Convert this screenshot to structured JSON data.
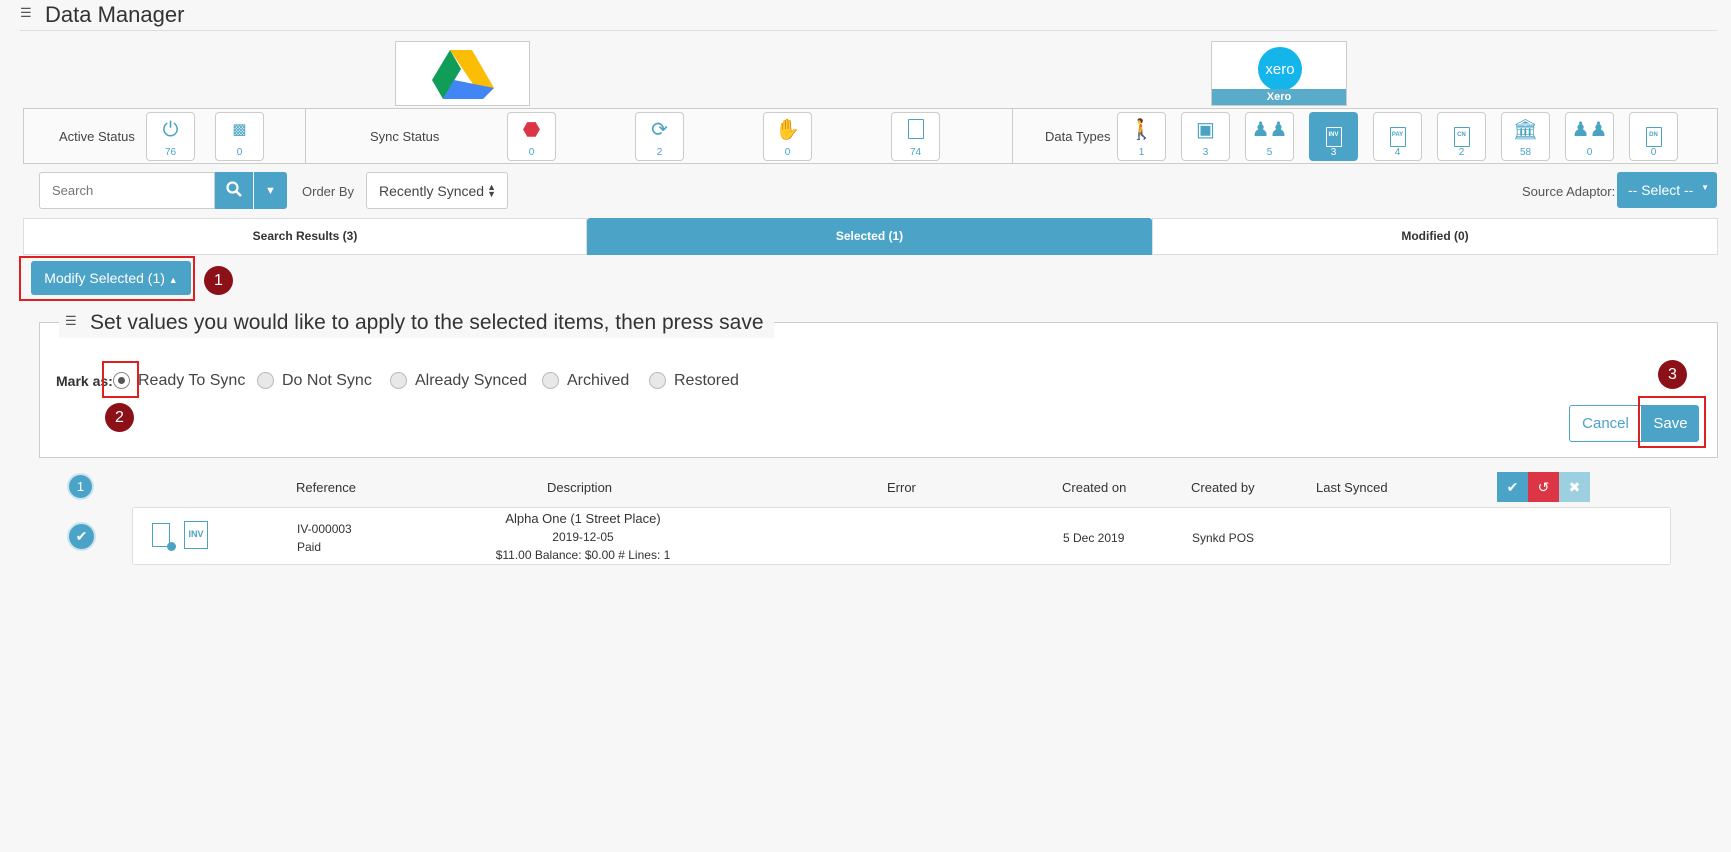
{
  "app": {
    "title": "Data Manager"
  },
  "sources": {
    "right_label": "Xero",
    "right_logo_text": "xero"
  },
  "active_status": {
    "label": "Active Status",
    "tiles": [
      {
        "icon": "power-icon",
        "count": "76"
      },
      {
        "icon": "archive-icon",
        "count": "0"
      }
    ]
  },
  "sync_status": {
    "label": "Sync Status",
    "tiles": [
      {
        "icon": "error-icon",
        "count": "0"
      },
      {
        "icon": "refresh-icon",
        "count": "2"
      },
      {
        "icon": "hand-stop-icon",
        "count": "0"
      },
      {
        "icon": "doc-synced-icon",
        "count": "74"
      }
    ]
  },
  "data_types": {
    "label": "Data Types",
    "tiles": [
      {
        "icon": "person-trolley-icon",
        "count": "1"
      },
      {
        "icon": "box-icon",
        "count": "3"
      },
      {
        "icon": "people-icon",
        "count": "5"
      },
      {
        "icon": "invoice-icon",
        "glyph": "INV",
        "count": "3",
        "active": true
      },
      {
        "icon": "payment-icon",
        "glyph": "PAY",
        "count": "4"
      },
      {
        "icon": "credit-note-icon",
        "glyph": "CN",
        "count": "2"
      },
      {
        "icon": "bank-icon",
        "count": "58"
      },
      {
        "icon": "people-icon",
        "count": "0"
      },
      {
        "icon": "debit-note-icon",
        "glyph": "DN",
        "count": "0"
      }
    ]
  },
  "toolbar": {
    "search_placeholder": "Search",
    "order_by_label": "Order By",
    "order_by_value": "Recently Synced",
    "source_adaptor_label": "Source Adaptor:",
    "source_adaptor_value": "-- Select --"
  },
  "tabs": [
    {
      "label": "Search Results (3)"
    },
    {
      "label": "Selected (1)",
      "active": true
    },
    {
      "label": "Modified (0)"
    }
  ],
  "modify": {
    "button_label": "Modify Selected (1)",
    "legend": "Set values you would like to apply to the selected items, then press save",
    "mark_as_label": "Mark as:",
    "options": [
      "Ready To Sync",
      "Do Not Sync",
      "Already Synced",
      "Archived",
      "Restored"
    ],
    "selected_option": "Ready To Sync",
    "cancel_label": "Cancel",
    "save_label": "Save"
  },
  "markers": [
    "1",
    "2",
    "3"
  ],
  "results": {
    "count": "1",
    "columns": [
      "Reference",
      "Description",
      "Error",
      "Created on",
      "Created by",
      "Last Synced"
    ],
    "rows": [
      {
        "type_glyph": "INV",
        "reference": "IV-000003",
        "status": "Paid",
        "desc_line1": "Alpha One (1 Street Place)",
        "desc_line2": "2019-12-05",
        "desc_line3": "$11.00 Balance: $0.00 # Lines: 1",
        "error": "",
        "created_on": "5 Dec 2019",
        "created_by": "Synkd POS",
        "last_synced": ""
      }
    ]
  },
  "colors": {
    "accent": "#4ba3c7",
    "danger": "#dc3545",
    "marker": "#8b1018",
    "highlight_box": "#e02020"
  }
}
